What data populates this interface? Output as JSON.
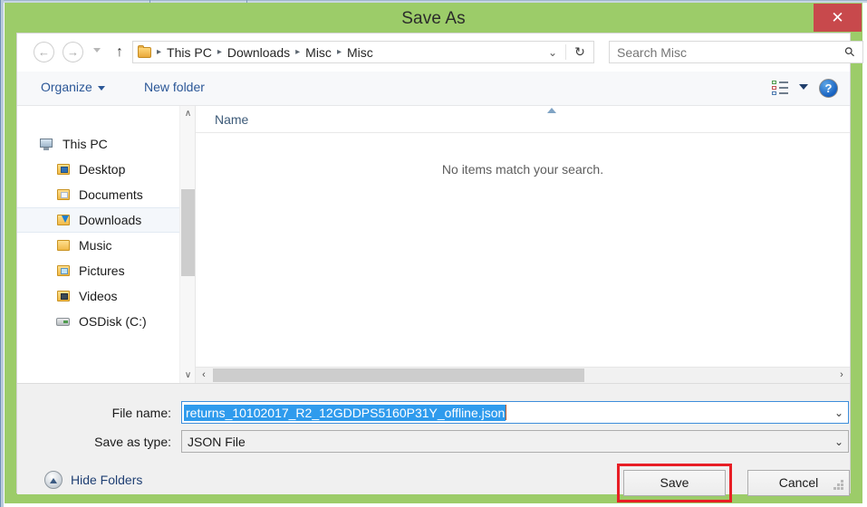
{
  "window": {
    "title": "Save As",
    "close_label": "✕",
    "chrome_color": "#9ccc69",
    "close_color": "#c8494c"
  },
  "navbar": {
    "back_icon": "←",
    "forward_icon": "→",
    "up_icon": "↑",
    "recent_icon": "chevron-down",
    "address": {
      "folder_icon": "folder-icon",
      "crumbs": [
        "This PC",
        "Downloads",
        "Misc",
        "Misc"
      ],
      "separator": "▸",
      "dropdown_icon": "⌄",
      "refresh_icon": "↻"
    },
    "search": {
      "placeholder": "Search Misc",
      "value": "",
      "icon": "⚲"
    }
  },
  "toolbar": {
    "organize_label": "Organize",
    "new_folder_label": "New folder",
    "view_icon": "list-view-icon",
    "view_caret_icon": "chevron-down-icon",
    "help_icon": "?"
  },
  "tree": {
    "items": [
      {
        "label": "This PC",
        "icon": "computer-icon",
        "level": 0,
        "selected": false
      },
      {
        "label": "Desktop",
        "icon": "desktop-folder-icon",
        "level": 1,
        "selected": false
      },
      {
        "label": "Documents",
        "icon": "documents-folder-icon",
        "level": 1,
        "selected": false
      },
      {
        "label": "Downloads",
        "icon": "downloads-folder-icon",
        "level": 1,
        "selected": true
      },
      {
        "label": "Music",
        "icon": "music-folder-icon",
        "level": 1,
        "selected": false
      },
      {
        "label": "Pictures",
        "icon": "pictures-folder-icon",
        "level": 1,
        "selected": false
      },
      {
        "label": "Videos",
        "icon": "videos-folder-icon",
        "level": 1,
        "selected": false
      },
      {
        "label": "OSDisk (C:)",
        "icon": "harddisk-icon",
        "level": 1,
        "selected": false
      }
    ],
    "scroll_up_icon": "∧",
    "scroll_down_icon": "∨"
  },
  "list": {
    "column_header": "Name",
    "sort_direction": "ascending",
    "empty_message": "No items match your search.",
    "scroll_left_icon": "‹",
    "scroll_right_icon": "›"
  },
  "form": {
    "filename_label": "File name:",
    "filename_value": "returns_10102017_R2_12GDDPS5160P31Y_offline.json",
    "filename_dropdown_icon": "⌄",
    "savetype_label": "Save as type:",
    "savetype_value": "JSON File",
    "savetype_dropdown_icon": "⌄",
    "hide_folders_label": "Hide Folders",
    "hide_folders_icon": "chevron-up-circle-icon"
  },
  "buttons": {
    "save_label": "Save",
    "cancel_label": "Cancel"
  },
  "annotation": {
    "highlight_target": "save-button",
    "highlight_color": "#e81e25"
  }
}
